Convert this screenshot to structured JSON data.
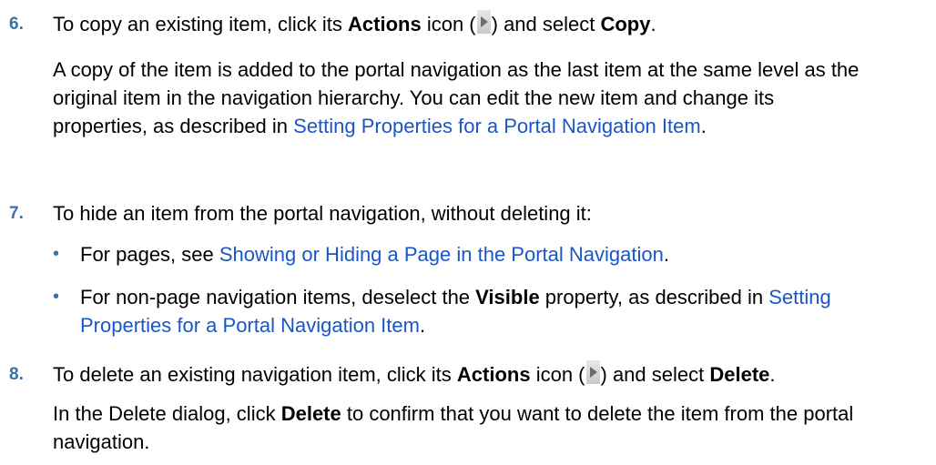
{
  "steps": [
    {
      "number": "6.",
      "intro_pre": "To copy an existing item, click its ",
      "intro_bold1": "Actions",
      "intro_mid": " icon (",
      "intro_icon": "actions-icon",
      "intro_post": ") and select ",
      "intro_bold2": "Copy",
      "intro_end": ".",
      "para_text": "A copy of the item is added to the portal navigation as the last item at the same level as the original item in the navigation hierarchy. You can edit the new item and change its properties, as described in ",
      "para_link": "Setting Properties for a Portal Navigation Item",
      "para_end": "."
    },
    {
      "number": "7.",
      "intro": "To hide an item from the portal navigation, without deleting it:",
      "bullets": [
        {
          "pre": "For pages, see ",
          "link": "Showing or Hiding a Page in the Portal Navigation",
          "end": "."
        },
        {
          "pre": "For non-page navigation items, deselect the ",
          "bold": "Visible",
          "mid": " property, as described in ",
          "link": "Setting Properties for a Portal Navigation Item",
          "end": "."
        }
      ]
    },
    {
      "number": "8.",
      "intro_pre": "To delete an existing navigation item, click its ",
      "intro_bold1": "Actions",
      "intro_mid": " icon (",
      "intro_icon": "actions-icon",
      "intro_post": ") and select ",
      "intro_bold2": "Delete",
      "intro_end": ".",
      "para_pre": "In the Delete dialog, click ",
      "para_bold": "Delete",
      "para_post": " to confirm that you want to delete the item from the portal navigation."
    }
  ],
  "colors": {
    "link": "#1a56c6",
    "step_number": "#3a6fa8",
    "text": "#000000"
  }
}
